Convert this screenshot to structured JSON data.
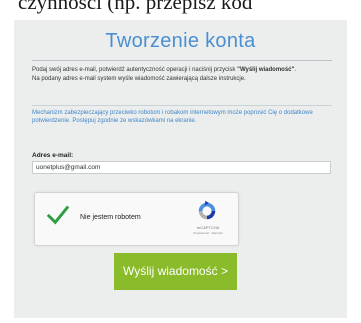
{
  "top_strip_text": "czynności (np. przepisz kod",
  "title": "Tworzenie konta",
  "intro": {
    "line1": "Podaj swój adres e-mail, potwierdź autentyczność operacji i naciśnij przycisk",
    "button_ref": "\"Wyślij wiadomość\"",
    "line1_end": ".",
    "line2": "Na podany adres e-mail system wyśle wiadomość zawierającą dalsze instrukcje."
  },
  "robot_notice": "Mechanizm zabezpieczający przeciwko robotom i robakom internetowym może poprosić Cię o dodatkowe potwierdzenie. Postępuj zgodnie ze wskazówkami na ekranie.",
  "email": {
    "label": "Adres e-mail:",
    "value": "uonetplus@gmail.com"
  },
  "captcha": {
    "label": "Nie jestem robotem",
    "brand": "reCAPTCHA",
    "links": "Prywatność - Warunki"
  },
  "submit_label": "Wyślij wiadomość >",
  "colors": {
    "title": "#4a8fd1",
    "notice": "#3f86c8",
    "submit": "#8abb2b",
    "check": "#2e9e43",
    "card": "#eceeee"
  }
}
